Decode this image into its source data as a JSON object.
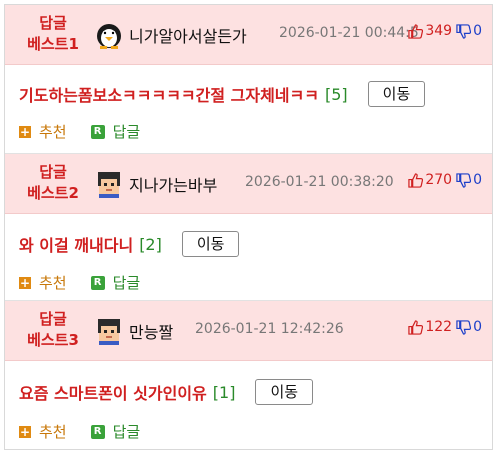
{
  "posts": [
    {
      "rank": [
        "답글",
        "베스트1"
      ],
      "nickname": "니가알아서살든가",
      "avatar_icon": "penguin-icon",
      "date": "2026-01-21 00:44:5",
      "up": "349",
      "down": "0",
      "title": "기도하는폼보소ㅋㅋㅋㅋㅋ간절 그자체네ㅋㅋ",
      "replies": "[5]",
      "move_label": "이동",
      "recommend_label": "추천",
      "reply_label": "답글"
    },
    {
      "rank": [
        "답글",
        "베스트2"
      ],
      "nickname": "지나가는바부",
      "avatar_icon": "pixel-boy-icon",
      "date": "2026-01-21 00:38:20",
      "up": "270",
      "down": "0",
      "title": "와 이걸 깨내다니",
      "replies": "[2]",
      "move_label": "이동",
      "recommend_label": "추천",
      "reply_label": "답글"
    },
    {
      "rank": [
        "답글",
        "베스트3"
      ],
      "nickname": "만능짤",
      "avatar_icon": "pixel-boy-icon",
      "date": "2026-01-21 12:42:26",
      "up": "122",
      "down": "0",
      "title": "요즘 스마트폰이 싯가인이유",
      "replies": "[1]",
      "move_label": "이동",
      "recommend_label": "추천",
      "reply_label": "답글"
    }
  ],
  "colors": {
    "accent_red": "#d02020",
    "header_pink": "#fde1e1",
    "down_blue": "#1d3fc9",
    "reply_green": "#2a8a2a",
    "recommend_orange": "#c8780a"
  }
}
